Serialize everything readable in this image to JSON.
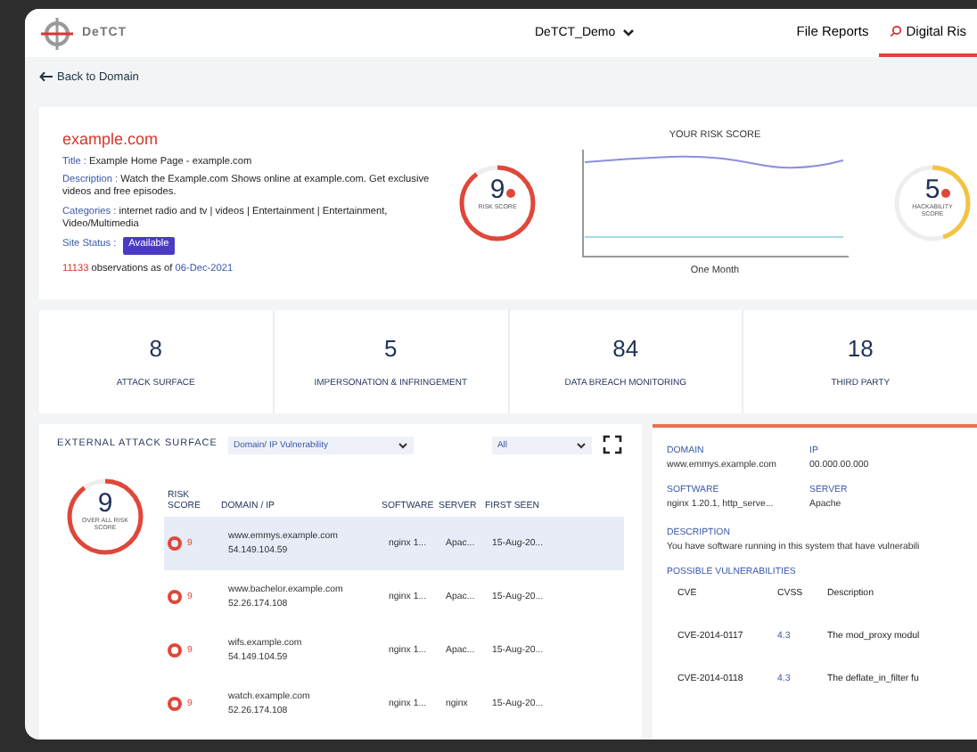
{
  "header": {
    "brand": "DeTCT",
    "workspace": "DeTCT_Demo",
    "nav": [
      {
        "label": "File Reports",
        "selected": false,
        "icon": false
      },
      {
        "label": "Digital Ris",
        "selected": true,
        "icon": true
      }
    ]
  },
  "back_link": "Back to Domain",
  "overview": {
    "domain": "example.com",
    "fields": [
      {
        "label": "Title :",
        "value": "Example Home Page - example.com"
      },
      {
        "label": "Description :",
        "value": "Watch the Example.com Shows online at example.com. Get exclusive videos and free episodes."
      },
      {
        "label": "Categories :",
        "value": "internet radio and tv | videos | Entertainment | Entertainment, Video/Multimedia"
      }
    ],
    "status_label": "Site Status :",
    "status": "Available",
    "observations_count": "11133",
    "observations_text": "observations as of",
    "observations_date": "06-Dec-2021",
    "risk_score": {
      "value": "9",
      "label": "RISK SCORE",
      "level": 0.9
    },
    "chart_title": "YOUR RISK SCORE",
    "chart_xlabel": "One Month",
    "hackability": {
      "value": "5",
      "label": "HACKABILITY SCORE",
      "level": 0.45
    }
  },
  "stats": [
    {
      "value": "8",
      "label": "ATTACK SURFACE"
    },
    {
      "value": "5",
      "label": "IMPERSONATION & INFRINGEMENT"
    },
    {
      "value": "84",
      "label": "DATA BREACH MONITORING"
    },
    {
      "value": "18",
      "label": "THIRD PARTY"
    }
  ],
  "attack_surface": {
    "title": "EXTERNAL ATTACK SURFACE",
    "filter": "Domain/ IP Vulnerability",
    "scope": "All",
    "overall": {
      "value": "9",
      "label": "OVER ALL RISK SCORE",
      "level": 0.9
    },
    "columns": [
      "RISK SCORE",
      "DOMAIN / IP",
      "SOFTWARE",
      "SERVER",
      "FIRST SEEN"
    ],
    "rows": [
      {
        "score": "9",
        "domain": "www.emmys.example.com",
        "ip": "54.149.104.59",
        "software": "nginx 1...",
        "server": "Apac...",
        "first_seen": "15-Aug-20...",
        "selected": true
      },
      {
        "score": "9",
        "domain": "www.bachelor.example.com",
        "ip": "52.26.174.108",
        "software": "nginx 1...",
        "server": "Apac...",
        "first_seen": "15-Aug-20...",
        "selected": false
      },
      {
        "score": "9",
        "domain": "wifs.example.com",
        "ip": "54.149.104.59",
        "software": "nginx 1...",
        "server": "Apac...",
        "first_seen": "15-Aug-20...",
        "selected": false
      },
      {
        "score": "9",
        "domain": "watch.example.com",
        "ip": "52.26.174.108",
        "software": "nginx 1...",
        "server": "nginx",
        "first_seen": "15-Aug-20...",
        "selected": false
      }
    ]
  },
  "detail": {
    "fields": [
      {
        "label": "DOMAIN",
        "value": "www.emmys.example.com"
      },
      {
        "label": "IP",
        "value": "00.000.00.000"
      },
      {
        "label": "SOFTWARE",
        "value": "nginx 1.20.1, http_serve..."
      },
      {
        "label": "SERVER",
        "value": "Apache"
      }
    ],
    "description_label": "DESCRIPTION",
    "description": "You have software running in this system that have vulnerabili",
    "vulns_title": "POSSIBLE VULNERABILITIES",
    "vuln_columns": [
      "CVE",
      "CVSS",
      "Description"
    ],
    "vulns": [
      {
        "cve": "CVE-2014-0117",
        "cvss": "4.3",
        "description": "The mod_proxy modul"
      },
      {
        "cve": "CVE-2014-0118",
        "cvss": "4.3",
        "description": "The deflate_in_filter fu"
      }
    ]
  }
}
